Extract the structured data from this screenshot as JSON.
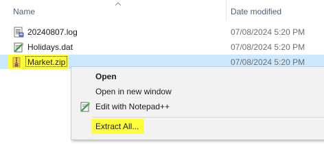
{
  "header": {
    "name_label": "Name",
    "date_label": "Date modified",
    "sort_icon": "chevron-up-icon"
  },
  "files": [
    {
      "name": "20240807.log",
      "date": "07/08/2024 5:20 PM",
      "icon": "log-file-icon"
    },
    {
      "name": "Holidays.dat",
      "date": "07/08/2024 5:20 PM",
      "icon": "notepad-file-icon"
    },
    {
      "name": "Market.zip",
      "date": "07/08/2024 5:20 PM",
      "icon": "zip-folder-icon",
      "selected": true
    }
  ],
  "context_menu": {
    "items": [
      {
        "label": "Open"
      },
      {
        "label": "Open in new window"
      },
      {
        "label": "Edit with Notepad++",
        "icon": "notepadpp-icon"
      },
      {
        "label": "Extract All..."
      }
    ]
  },
  "colors": {
    "selection": "#cce8ff",
    "highlight": "#ffff3a",
    "menu_bg": "#f2f2f2",
    "header_text": "#4c607a"
  }
}
